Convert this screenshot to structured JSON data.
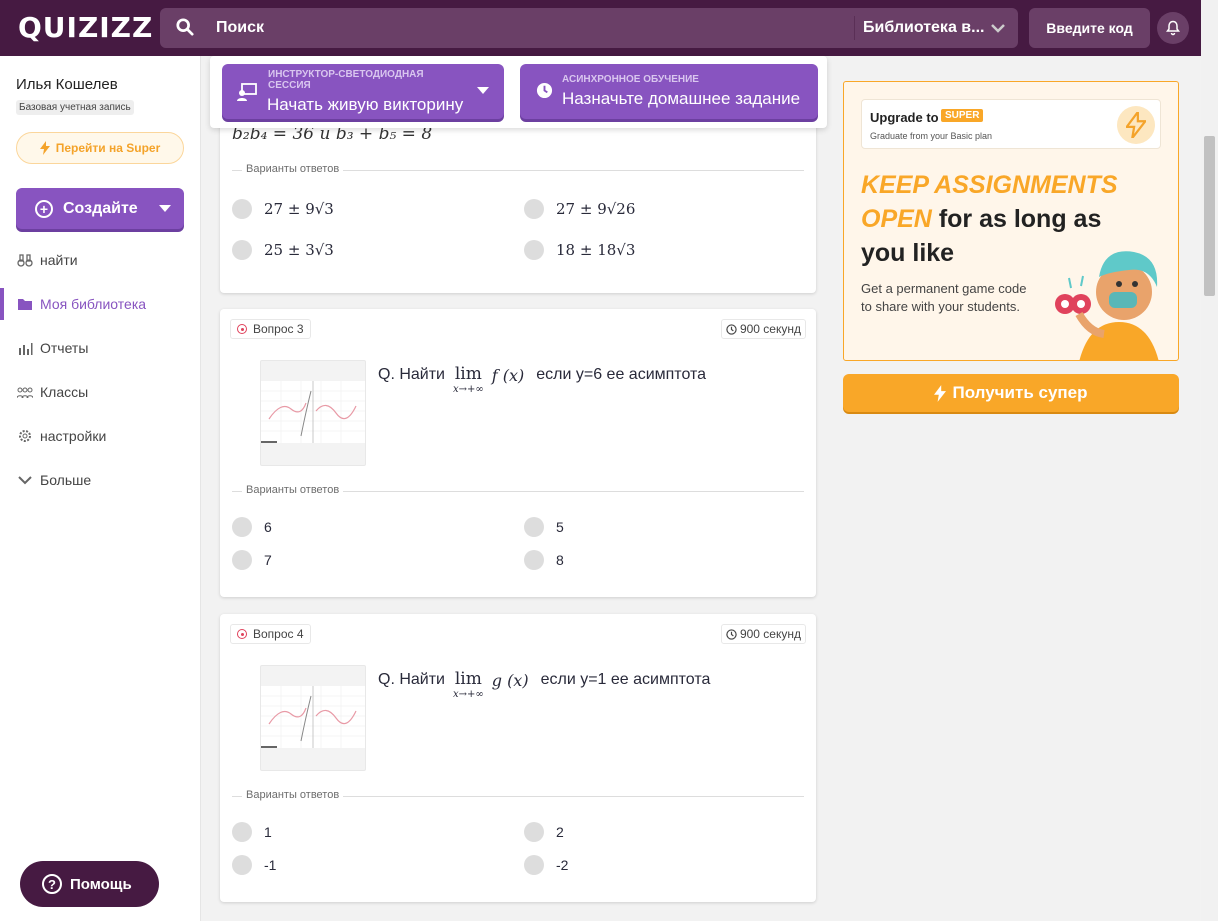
{
  "header": {
    "logo": "QUIZIZZ",
    "search_placeholder": "Поиск",
    "library_select": "Библиотека в...",
    "enter_code": "Введите код"
  },
  "sidebar": {
    "user_name": "Илья Кошелев",
    "account_type": "Базовая учетная запись",
    "super_link": "Перейти на Super",
    "create": "Создайте",
    "nav": [
      {
        "label": "найти",
        "icon": "binoculars-icon"
      },
      {
        "label": "Моя библиотека",
        "icon": "folder-icon",
        "active": true
      },
      {
        "label": "Отчеты",
        "icon": "reports-icon"
      },
      {
        "label": "Классы",
        "icon": "classes-icon"
      },
      {
        "label": "настройки",
        "icon": "gear-icon"
      },
      {
        "label": "Больше",
        "icon": "chevron-down-icon"
      }
    ],
    "help": "Помощь"
  },
  "session_bar": {
    "live": {
      "small": "ИНСТРУКТОР-СВЕТОДИОДНАЯ СЕССИЯ",
      "big": "Начать живую викторину"
    },
    "async": {
      "small": "АСИНХРОННОЕ ОБУЧЕНИЕ",
      "big": "Назначьте домашнее задание"
    }
  },
  "questions": [
    {
      "partial_text": "b₂b₄ = 36  и  b₃ + b₅ = 8",
      "variants_label": "Варианты ответов",
      "options": [
        "27 ± 9√3",
        "27 ± 9√26",
        "25 ± 3√3",
        "18 ± 18√3"
      ]
    },
    {
      "label": "Вопрос 3",
      "time": "900 секунд",
      "q_prefix": "Q. Найти",
      "lim_top": "lim",
      "lim_bottom": "x→+∞",
      "func": "f (x)",
      "q_suffix": "если y=6 ее асимптота",
      "variants_label": "Варианты ответов",
      "options": [
        "6",
        "5",
        "7",
        "8"
      ]
    },
    {
      "label": "Вопрос 4",
      "time": "900 секунд",
      "q_prefix": "Q. Найти",
      "lim_top": "lim",
      "lim_bottom": "x→+∞",
      "func": "g (x)",
      "q_suffix": "если y=1 ее асимптота",
      "variants_label": "Варианты ответов",
      "options": [
        "1",
        "2",
        "-1",
        "-2"
      ]
    }
  ],
  "promo": {
    "upgrade_to": "Upgrade to",
    "super_badge": "SUPER",
    "graduate": "Graduate from your Basic plan",
    "headline_orange": "KEEP ASSIGNMENTS OPEN",
    "headline_black": "for as long as you like",
    "description": "Get a permanent game code to share with your students.",
    "cta": "Получить супер"
  },
  "colors": {
    "brand": "#461a42",
    "purple": "#8854c0",
    "orange": "#f9a728"
  }
}
